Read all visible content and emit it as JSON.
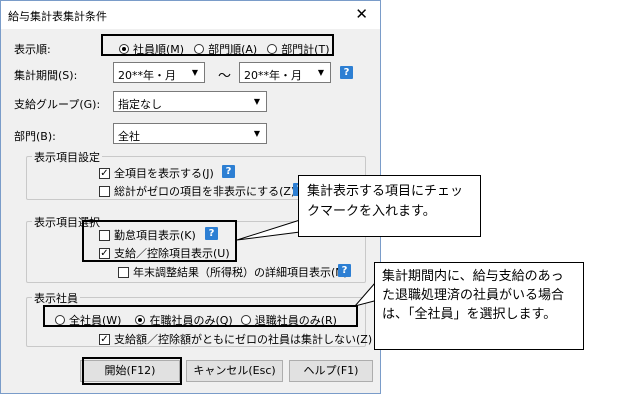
{
  "dialog": {
    "title": "給与集計表集計条件",
    "close_symbol": "✕"
  },
  "display_order": {
    "label": "表示順:",
    "options": [
      "社員順(M)",
      "部門順(A)",
      "部門計(T)"
    ],
    "selected": 0
  },
  "period": {
    "label": "集計期間(S):",
    "from_value": "20**年・月",
    "separator": "〜",
    "to_value": "20**年・月"
  },
  "pay_group": {
    "label": "支給グループ(G):",
    "value": "指定なし"
  },
  "department": {
    "label": "部門(B):",
    "value": "全社"
  },
  "display_settings": {
    "title": "表示項目設定",
    "show_all": "全項目を表示する(J)",
    "hide_zero": "総計がゼロの項目を非表示にする(Z)"
  },
  "item_select": {
    "title": "表示項目選択",
    "attendance": "勤怠項目表示(K)",
    "payment": "支給／控除項目表示(U)",
    "year_end": "年末調整結果（所得税）の詳細項目表示(N)"
  },
  "employees": {
    "title": "表示社員",
    "options": [
      "全社員(W)",
      "在職社員のみ(Q)",
      "退職社員のみ(R)"
    ],
    "selected": 1,
    "exclude_zero": "支給額／控除額がともにゼロの社員は集計しない(Z)"
  },
  "buttons": {
    "start": "開始(F12)",
    "cancel": "キャンセル(Esc)",
    "help": "ヘルプ(F1)"
  },
  "callouts": {
    "first": "集計表示する項目にチェックマークを入れます。",
    "second": "集計期間内に、給与支給のあった退職処理済の社員がいる場合は、「全社員」を選択します。"
  },
  "icons": {
    "help": "help-icon",
    "dropdown": "chevron-down-icon"
  }
}
